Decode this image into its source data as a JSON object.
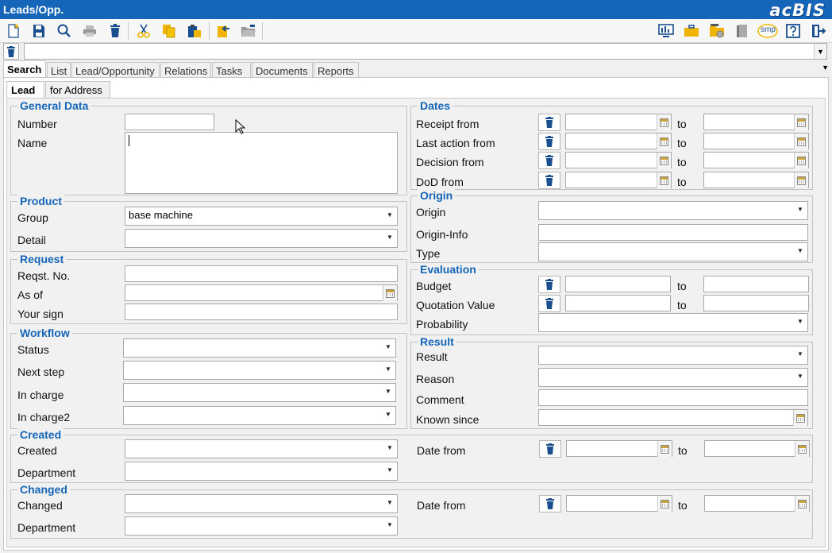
{
  "window": {
    "title": "Leads/Opp.",
    "logo": "acBIS"
  },
  "toolbar": {
    "left": [
      "new-icon",
      "save-icon",
      "search-icon",
      "print-icon",
      "delete-icon",
      "cut-icon",
      "copy-icon",
      "paste-icon",
      "export-icon",
      "open-folder-icon"
    ],
    "right": [
      "monitor-icon",
      "briefcase-icon",
      "folder-settings-icon",
      "book-icon",
      "smp-icon",
      "help-icon",
      "exit-icon"
    ],
    "smp_label": "smp"
  },
  "tabs": [
    "Search",
    "List",
    "Lead/Opportunity",
    "Relations",
    "Tasks",
    "Documents",
    "Reports"
  ],
  "subtabs": [
    "Lead",
    "for Address"
  ],
  "general": {
    "title": "General Data",
    "number_label": "Number",
    "number_value": "",
    "name_label": "Name",
    "name_value": ""
  },
  "product": {
    "title": "Product",
    "group_label": "Group",
    "group_value": "base machine",
    "detail_label": "Detail",
    "detail_value": ""
  },
  "request": {
    "title": "Request",
    "reqst_label": "Reqst. No.",
    "asof_label": "As of",
    "yoursign_label": "Your sign"
  },
  "workflow": {
    "title": "Workflow",
    "status_label": "Status",
    "nextstep_label": "Next step",
    "incharge_label": "In charge",
    "incharge2_label": "In charge2"
  },
  "created": {
    "title": "Created",
    "created_label": "Created",
    "department_label": "Department",
    "datefrom_label": "Date from",
    "to_label": "to"
  },
  "changed": {
    "title": "Changed",
    "changed_label": "Changed",
    "department_label": "Department",
    "datefrom_label": "Date from",
    "to_label": "to"
  },
  "dates": {
    "title": "Dates",
    "receipt_label": "Receipt from",
    "lastaction_label": "Last action from",
    "decision_label": "Decision from",
    "dod_label": "DoD from",
    "to_label": "to"
  },
  "origin": {
    "title": "Origin",
    "origin_label": "Origin",
    "info_label": "Origin-Info",
    "type_label": "Type"
  },
  "evaluation": {
    "title": "Evaluation",
    "budget_label": "Budget",
    "quotation_label": "Quotation Value",
    "probability_label": "Probability",
    "to_label": "to"
  },
  "result": {
    "title": "Result",
    "result_label": "Result",
    "reason_label": "Reason",
    "comment_label": "Comment",
    "knownsince_label": "Known since"
  },
  "colors": {
    "titlebar": "#1565b8",
    "group_title": "#1565b8"
  }
}
